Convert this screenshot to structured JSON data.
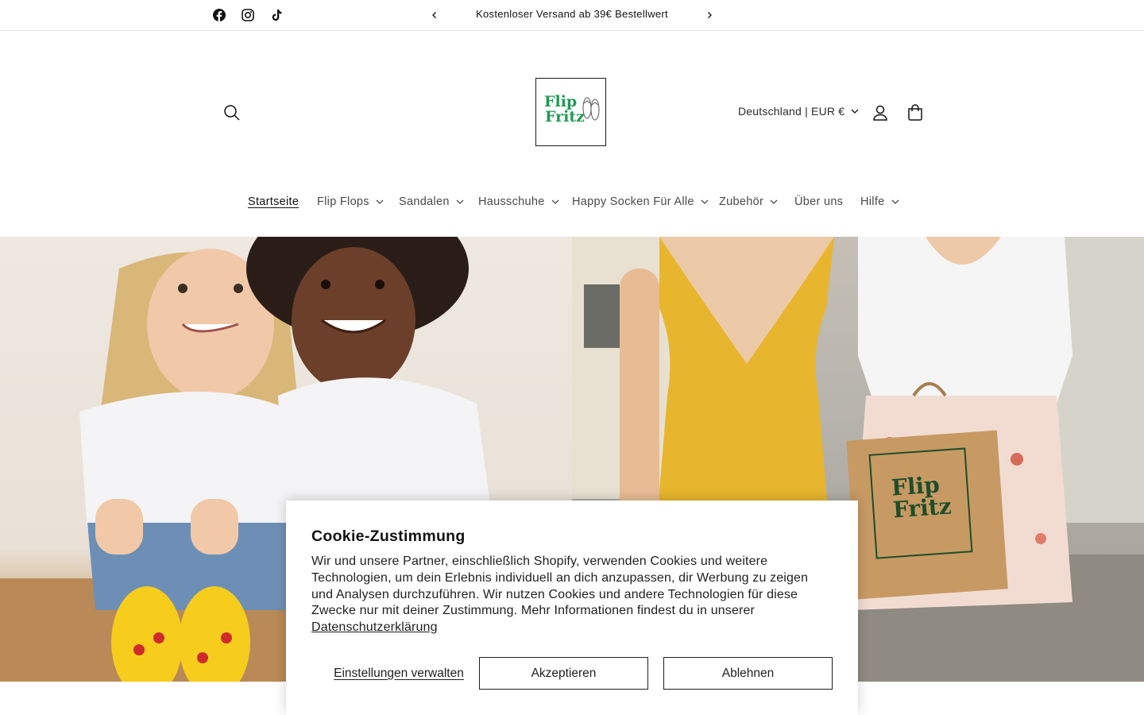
{
  "announcement": {
    "text": "Kostenloser Versand ab 39€ Bestellwert",
    "prev_icon": "chevron-left-icon",
    "next_icon": "chevron-right-icon"
  },
  "social": [
    "facebook-icon",
    "instagram-icon",
    "tiktok-icon"
  ],
  "logo": {
    "line1": "Flip",
    "line2": "Fritz"
  },
  "header": {
    "locale": "Deutschland | EUR €",
    "icons": [
      "search-icon",
      "account-icon",
      "cart-icon"
    ]
  },
  "nav": {
    "items": [
      {
        "label": "Startseite",
        "dropdown": false,
        "active": true
      },
      {
        "label": "Flip Flops",
        "dropdown": true
      },
      {
        "label": "Sandalen",
        "dropdown": true
      },
      {
        "label": "Hausschuhe",
        "dropdown": true
      },
      {
        "label": "Happy Socken Für Alle",
        "dropdown": true
      },
      {
        "label": "Zubehör",
        "dropdown": true
      },
      {
        "label": "Über uns",
        "dropdown": false
      },
      {
        "label": "Hilfe",
        "dropdown": true
      }
    ]
  },
  "hero": {
    "bag_logo": {
      "line1": "Flip",
      "line2": "Fritz"
    }
  },
  "cookie": {
    "title": "Cookie-Zustimmung",
    "body": "Wir und unsere Partner, einschließlich Shopify, verwenden Cookies und weitere Technologien, um dein Erlebnis individuell an dich anzupassen, dir Werbung zu zeigen und Analysen durchzuführen. Wir nutzen Cookies und andere Technologien für diese Zwecke nur mit deiner Zustimmung. Mehr Informationen findest du in unserer",
    "link": "Datenschutzerklärung",
    "manage": "Einstellungen verwalten",
    "accept": "Akzeptieren",
    "decline": "Ablehnen"
  },
  "colors": {
    "brand_green": "#1f9a55",
    "text": "#121212",
    "dress_yellow": "#e8b62e"
  }
}
